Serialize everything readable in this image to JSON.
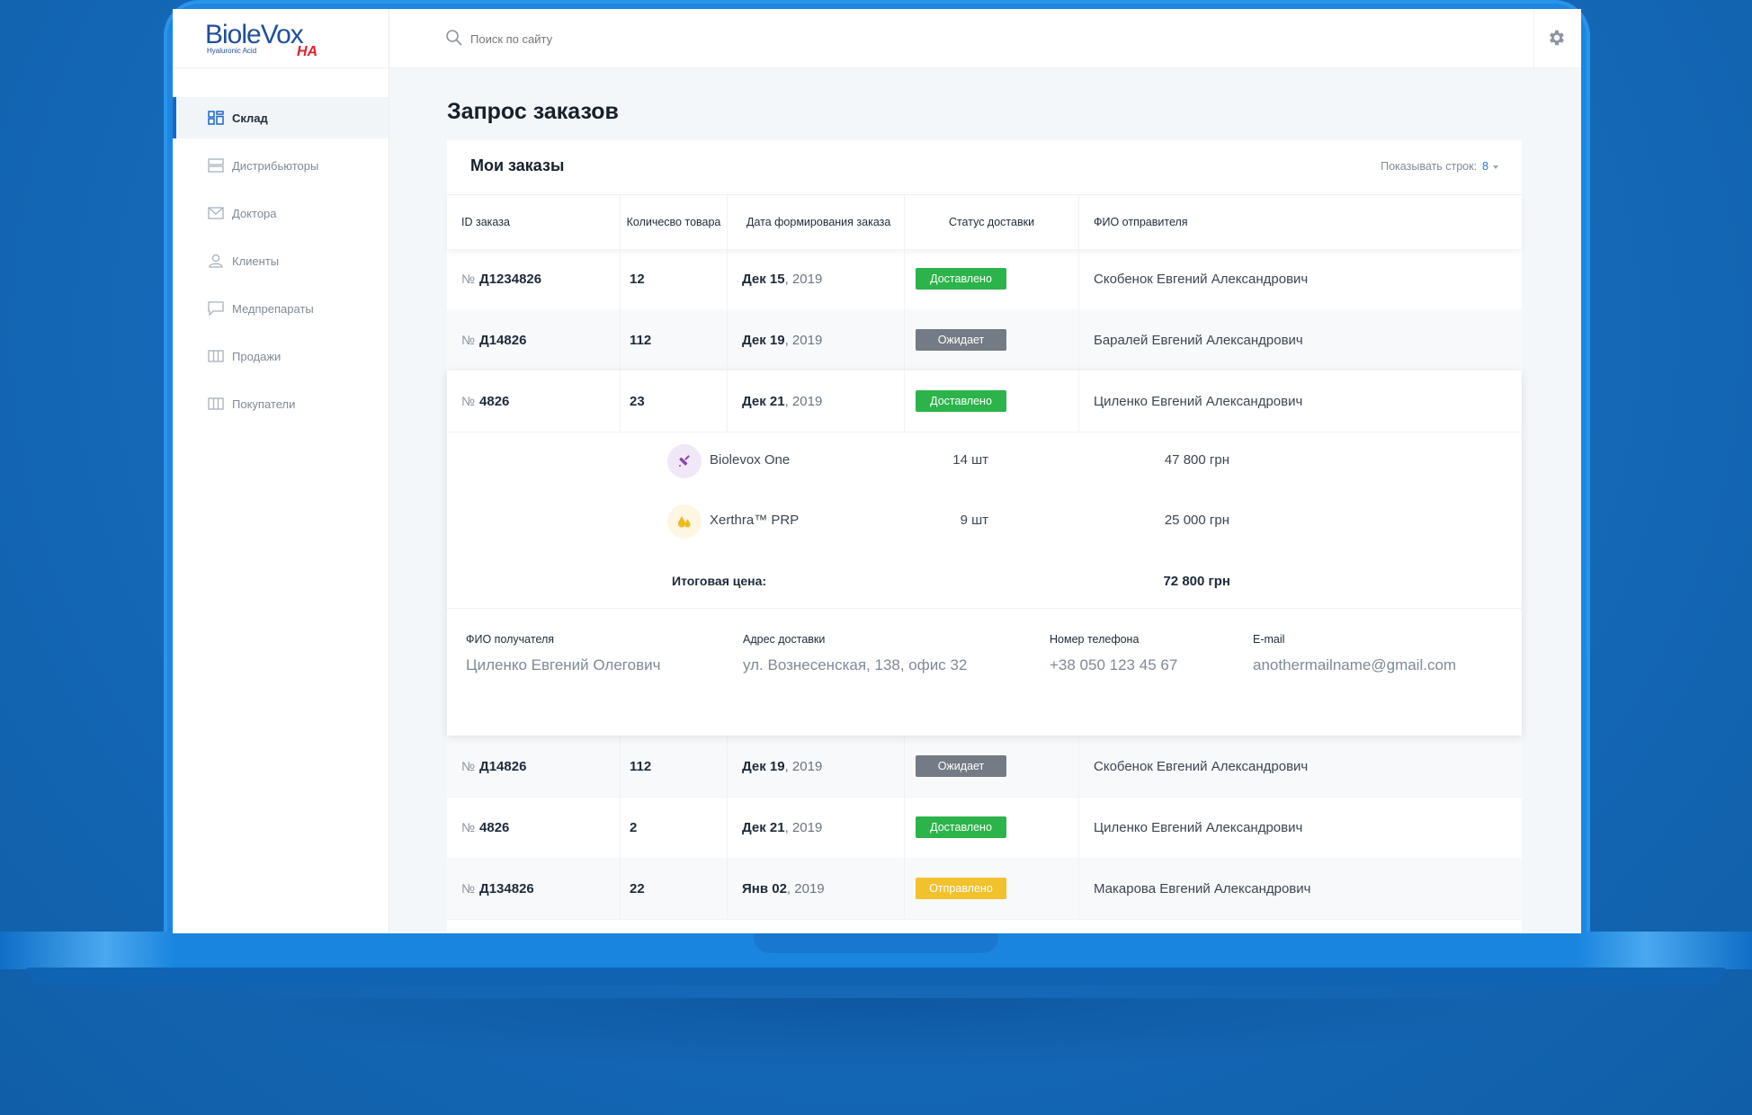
{
  "brand": {
    "name": "BioleVox",
    "subtitle": "Hyaluronic Acid",
    "suffix": "HA"
  },
  "sidebar": {
    "items": [
      {
        "label": "Склад",
        "icon": "grid-icon",
        "active": true
      },
      {
        "label": "Дистрибьюторы",
        "icon": "server-icon"
      },
      {
        "label": "Доктора",
        "icon": "envelope-icon"
      },
      {
        "label": "Клиенты",
        "icon": "user-icon"
      },
      {
        "label": "Медпрепараты",
        "icon": "chat-icon"
      },
      {
        "label": "Продажи",
        "icon": "columns-icon"
      },
      {
        "label": "Покупатели",
        "icon": "columns-icon"
      }
    ]
  },
  "search": {
    "placeholder": "Поиск по сайту"
  },
  "page": {
    "title": "Запрос заказов"
  },
  "card": {
    "title": "Мои заказы",
    "rows_label": "Показывать строк:",
    "rows_value": "8"
  },
  "table": {
    "headers": [
      "ID заказа",
      "Количесво товара",
      "Дата формирования заказа",
      "Статус доставки",
      "ФИО отправителя"
    ],
    "num_prefix": "№",
    "rows": [
      {
        "id": "Д1234826",
        "qty": "12",
        "date_day": "Дек 15",
        "date_year": ", 2019",
        "status": "Доставлено",
        "status_color": "#2cb34a",
        "name": "Скобенок Евгений Александрович"
      },
      {
        "id": "Д14826",
        "qty": "112",
        "date_day": "Дек 19",
        "date_year": ", 2019",
        "status": "Ожидает",
        "status_color": "#737b84",
        "name": "Баралей Евгений Александрович"
      },
      {
        "id": "4826",
        "qty": "23",
        "date_day": "Дек 21",
        "date_year": ", 2019",
        "status": "Доставлено",
        "status_color": "#2cb34a",
        "name": "Циленко Евгений Александрович"
      },
      {
        "id": "Д14826",
        "qty": "112",
        "date_day": "Дек 19",
        "date_year": ", 2019",
        "status": "Ожидает",
        "status_color": "#737b84",
        "name": "Скобенок Евгений Александрович"
      },
      {
        "id": "4826",
        "qty": "2",
        "date_day": "Дек 21",
        "date_year": ", 2019",
        "status": "Доставлено",
        "status_color": "#2cb34a",
        "name": "Циленко Евгений Александрович"
      },
      {
        "id": "Д134826",
        "qty": "22",
        "date_day": "Янв 02",
        "date_year": ", 2019",
        "status": "Отправлено",
        "status_color": "#f2c12e",
        "name": "Макарова Евгений Александрович"
      }
    ]
  },
  "expanded": {
    "products": [
      {
        "name": "Biolevox One",
        "qty": "14 шт",
        "price": "47 800 грн",
        "icon": "syringe-icon",
        "icon_color": "#8e44ad"
      },
      {
        "name": "Xerthra™ PRP",
        "qty": "9 шт",
        "price": "25 000 грн",
        "icon": "drops-icon",
        "icon_color": "#f2b91f"
      }
    ],
    "total_label": "Итоговая цена:",
    "total_value": "72 800 грн",
    "info": {
      "recipient_label": "ФИО получателя",
      "recipient_value": "Циленко Евгений Олегович",
      "address_label": "Адрес доставки",
      "address_value": "ул. Вознесенская, 138, офис 32",
      "phone_label": "Номер телефона",
      "phone_value": "+38 050 123 45 67",
      "email_label": "E-mail",
      "email_value": "anothermailname@gmail.com"
    }
  },
  "colors": {
    "accent": "#1b66c9",
    "background": "#1469b8",
    "delivered": "#2cb34a",
    "waiting": "#737b84",
    "sent": "#f2c12e"
  }
}
